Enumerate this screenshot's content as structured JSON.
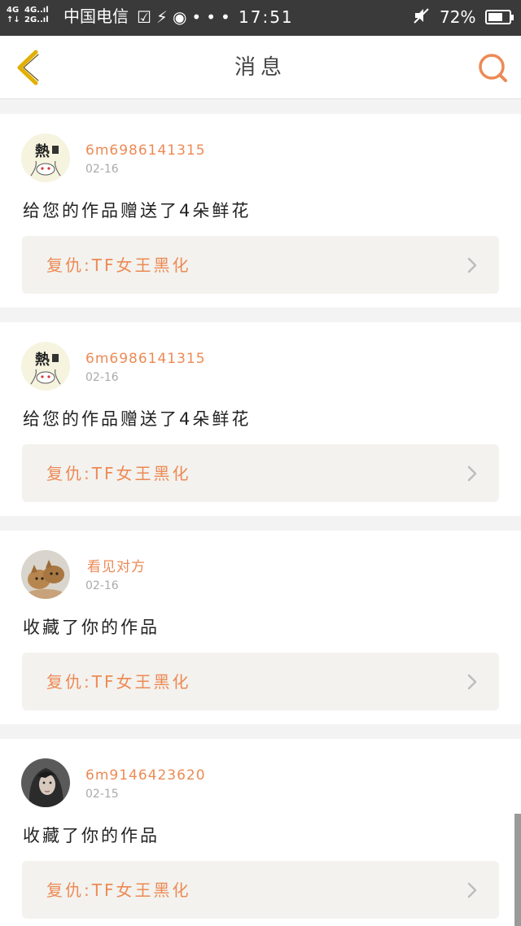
{
  "status_bar": {
    "network_left": "4G",
    "network_left2": "↑↓",
    "network_right": "4G..ıl",
    "network_right2": "2G..ıl",
    "carrier": "中国电信",
    "notification_icons": "☑⚡◉•••",
    "time": "17:51",
    "battery_percent": "72%",
    "battery_level": 0.72
  },
  "nav": {
    "title": "消息"
  },
  "notifications": [
    {
      "username": "6m6986141315",
      "date": "02-16",
      "message": "给您的作品赠送了4朵鲜花",
      "work_title": "复仇:TF女王黑化",
      "avatar_icon": "cartoon-hot-avatar-icon"
    },
    {
      "username": "6m6986141315",
      "date": "02-16",
      "message": "给您的作品赠送了4朵鲜花",
      "work_title": "复仇:TF女王黑化",
      "avatar_icon": "cartoon-hot-avatar-icon"
    },
    {
      "username": "看见对方",
      "date": "02-16",
      "message": "收藏了你的作品",
      "work_title": "复仇:TF女王黑化",
      "avatar_icon": "kittens-photo-avatar-icon"
    },
    {
      "username": "6m9146423620",
      "date": "02-15",
      "message": "收藏了你的作品",
      "work_title": "复仇:TF女王黑化",
      "avatar_icon": "girl-photo-avatar-icon"
    }
  ],
  "avatar_text": "熱",
  "colors": {
    "accent": "#ec8a55",
    "back_arrow": "#e2b000",
    "card_link_bg": "#f3f2ee"
  }
}
